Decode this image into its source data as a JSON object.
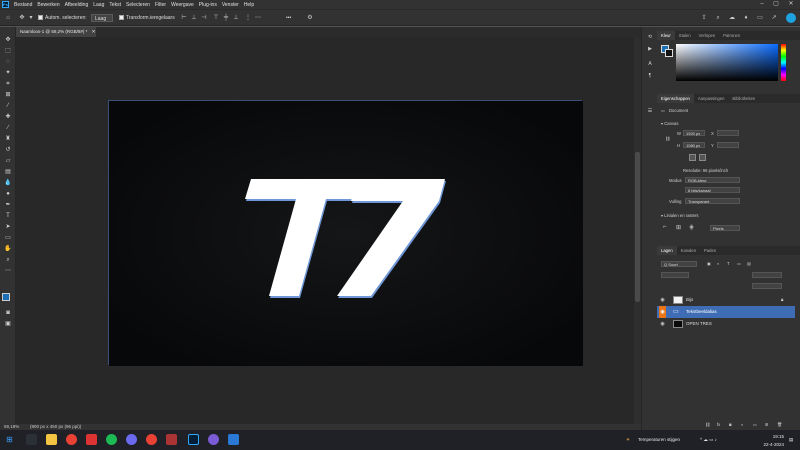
{
  "app": {
    "logo_text": "Ps"
  },
  "menu": [
    "Bestand",
    "Bewerken",
    "Afbeelding",
    "Laag",
    "Tekst",
    "Selecteren",
    "Filter",
    "Weergave",
    "Plug-ins",
    "Venster",
    "Help"
  ],
  "options": {
    "autoselect_label": "Autom. selecteren:",
    "autoselect_value": "Laag",
    "transform_label": "Transform.ieregelaars",
    "more_label": "•••"
  },
  "document": {
    "tab_title": "Naamloos-1 @ 59,2% (RGB/8#) *",
    "artwork_text": "T7"
  },
  "status": {
    "zoom": "59,18%",
    "size": "(800 px x 450 px (96 ppi))"
  },
  "color_panel": {
    "tabs": [
      "Kleur",
      "Stalen",
      "Verlopen",
      "Patronen"
    ]
  },
  "properties": {
    "tabs": [
      "Eigenschappen",
      "Aanpassingen",
      "Bibliotheken"
    ],
    "doc_label": "Document",
    "canvas_header": "Canvas",
    "width_prefix": "W",
    "width": "1920 px",
    "height_prefix": "H",
    "height": "1080 px",
    "x_prefix": "X",
    "y_prefix": "Y",
    "resolution": "Resolutie: 96 pixels/inch",
    "mode_label": "Modus",
    "mode_value": "RGB-kleur",
    "depth_value": "8 bits/kanaal",
    "fill_label": "Vulling",
    "fill_value": "Transparant",
    "rulers_header": "Linialen en rasters",
    "unit_value": "Pixels"
  },
  "layers": {
    "tabs": [
      "Lagen",
      "Kanalen",
      "Paden"
    ],
    "filter": "Q Soort",
    "items": [
      {
        "name": "Bijs",
        "locked": true,
        "selected": false
      },
      {
        "name": "Tekstbeeldalias",
        "locked": false,
        "selected": true
      },
      {
        "name": "OPEN TRES",
        "locked": false,
        "selected": false
      }
    ]
  },
  "taskbar": {
    "weather": "Temperaturen stijgen",
    "time": "19:15",
    "date": "22-4-2024"
  }
}
